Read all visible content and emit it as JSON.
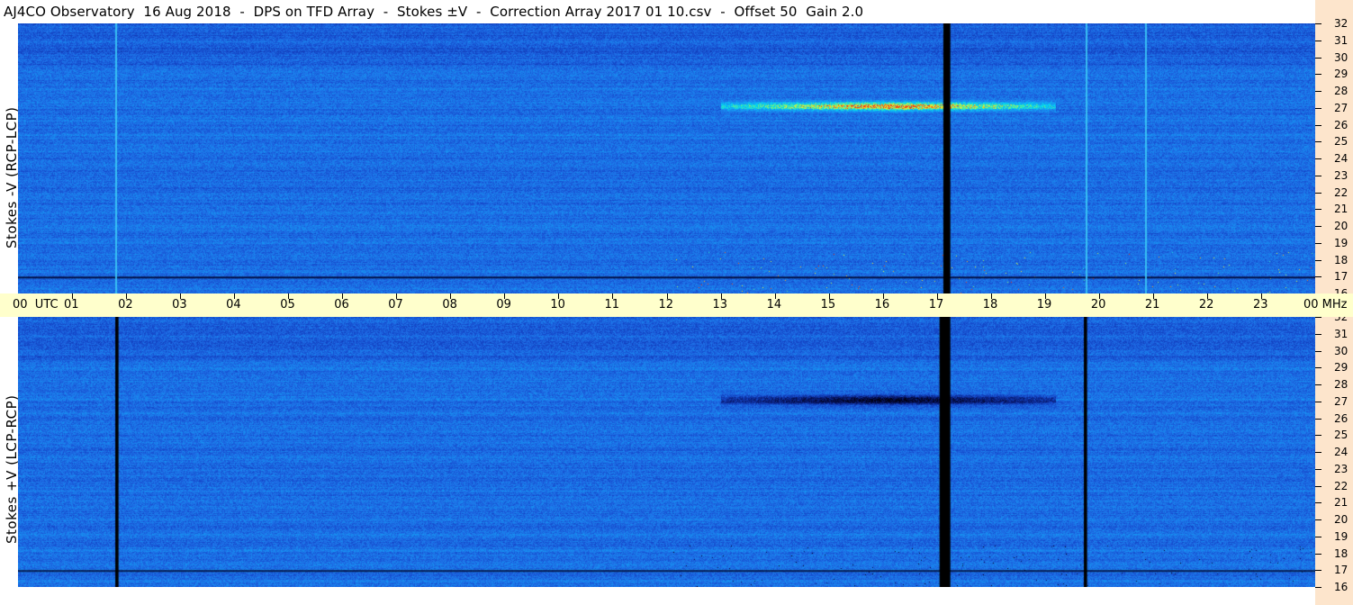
{
  "title": "AJ4CO Observatory  16 Aug 2018  -  DPS on TFD Array  -  Stokes ±V  -  Correction Array 2017 01 10.csv  -  Offset 50  Gain 2.0",
  "panels": {
    "top_label": "Stokes -V (RCP-LCP)",
    "bottom_label": "Stokes +V (LCP-RCP)"
  },
  "time_axis": {
    "start_label": "00  UTC",
    "hour_labels": [
      "01",
      "02",
      "03",
      "04",
      "05",
      "06",
      "07",
      "08",
      "09",
      "10",
      "11",
      "12",
      "13",
      "14",
      "15",
      "16",
      "17",
      "18",
      "19",
      "20",
      "21",
      "22",
      "23"
    ],
    "end_label": "00 MHz"
  },
  "freq_axis": {
    "labels": [
      "32",
      "31",
      "30",
      "29",
      "28",
      "27",
      "26",
      "25",
      "24",
      "23",
      "22",
      "21",
      "20",
      "19",
      "18",
      "17",
      "16"
    ]
  },
  "colors": {
    "background_blue": "#1e6fe0",
    "time_axis_bg": "#ffffcc",
    "freq_axis_bg": "#fde5cc"
  },
  "chart_data": {
    "type": "heatmap",
    "title": "AJ4CO Observatory  16 Aug 2018  -  DPS on TFD Array  -  Stokes ±V  -  Correction Array 2017 01 10.csv  -  Offset 50  Gain 2.0",
    "x": {
      "label": "UTC",
      "range": [
        0,
        24
      ],
      "unit": "hour"
    },
    "y": {
      "label": "MHz",
      "range": [
        16,
        32
      ],
      "unit": "MHz"
    },
    "panels": [
      {
        "name": "Stokes -V (RCP-LCP)",
        "emission_bands": [
          {
            "freq_mhz": 27.1,
            "t_start": 13,
            "t_end": 19.2,
            "strength": 0.9
          }
        ],
        "gaps": [
          {
            "t_start": 17.12,
            "t_end": 17.25
          }
        ],
        "bright_vertical_lines": [
          1.8,
          19.75,
          20.85
        ]
      },
      {
        "name": "Stokes +V (LCP-RCP)",
        "emission_bands": [
          {
            "freq_mhz": 27.1,
            "t_start": 13,
            "t_end": 19.2,
            "strength": -0.9
          }
        ],
        "gaps": [
          {
            "t_start": 1.8,
            "t_end": 1.86
          },
          {
            "t_start": 17.05,
            "t_end": 17.25
          },
          {
            "t_start": 19.72,
            "t_end": 19.78
          }
        ],
        "bright_vertical_lines": []
      }
    ]
  }
}
